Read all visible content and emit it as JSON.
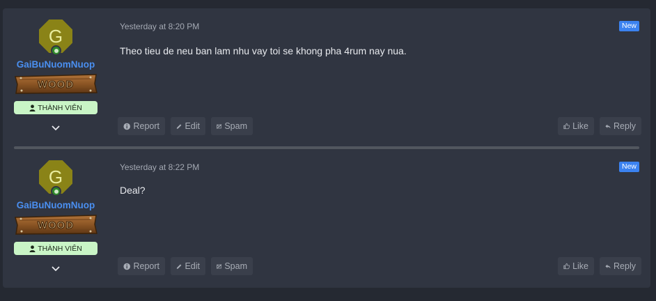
{
  "posts": [
    {
      "username": "GaiBuNuomNuop",
      "avatar_letter": "G",
      "avatar_color": "#8a8317",
      "rank_banner": "WOOD",
      "role": "THÀNH VIÊN",
      "time": "Yesterday at 8:20 PM",
      "badge": "New",
      "message": "Theo tieu de neu ban lam nhu vay toi se khong pha 4rum nay nua.",
      "actions": {
        "report": "Report",
        "edit": "Edit",
        "spam": "Spam",
        "like": "Like",
        "reply": "Reply"
      }
    },
    {
      "username": "GaiBuNuomNuop",
      "avatar_letter": "G",
      "avatar_color": "#8a8317",
      "rank_banner": "WOOD",
      "role": "THÀNH VIÊN",
      "time": "Yesterday at 8:22 PM",
      "badge": "New",
      "message": "Deal?",
      "actions": {
        "report": "Report",
        "edit": "Edit",
        "spam": "Spam",
        "like": "Like",
        "reply": "Reply"
      }
    }
  ],
  "colors": {
    "background": "#252932",
    "panel": "#303541",
    "username": "#4a8ff0",
    "badge_new": "#3b82f0",
    "role_badge": "#c9f5c6"
  },
  "icons": [
    "online-indicator-icon",
    "user-icon",
    "chevron-down-icon",
    "info-icon",
    "pencil-icon",
    "spam-icon",
    "thumbs-up-icon",
    "reply-icon"
  ]
}
